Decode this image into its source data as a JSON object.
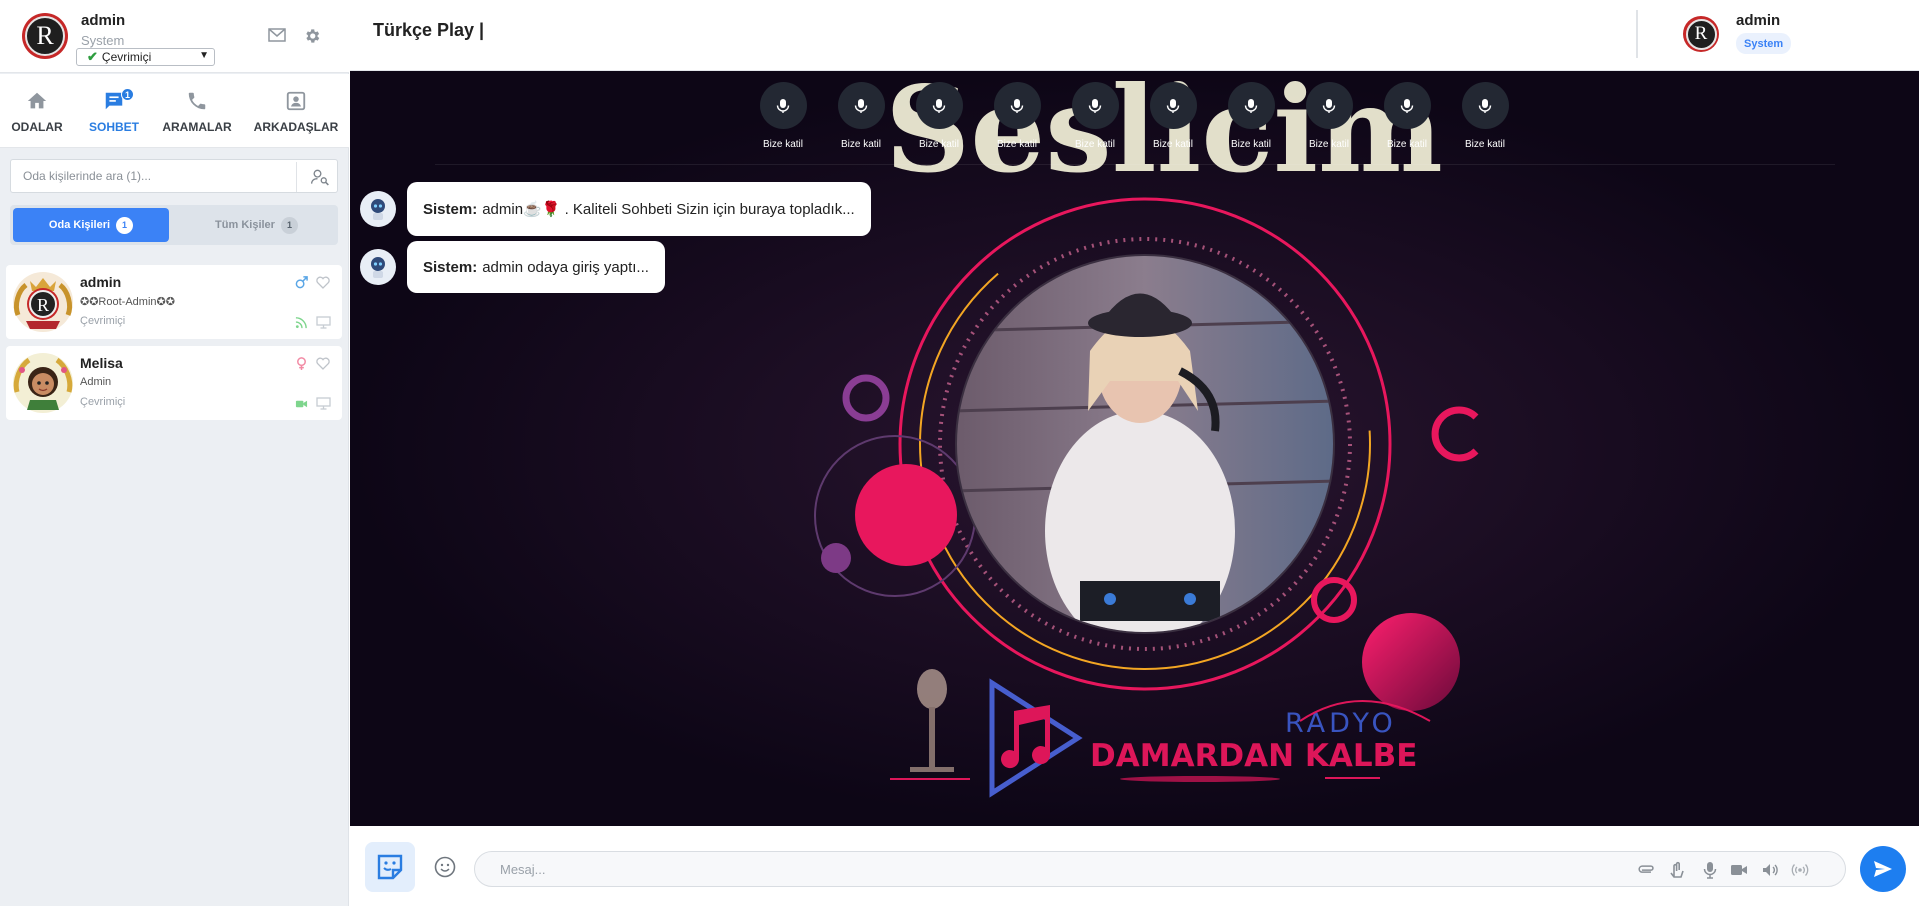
{
  "profile": {
    "name": "admin",
    "role": "System",
    "status": "Çevrimiçi"
  },
  "nav": {
    "tabs": [
      {
        "label": "ODALAR",
        "icon": "home-icon"
      },
      {
        "label": "SOHBET",
        "icon": "chat-icon",
        "badge": "1",
        "active": true
      },
      {
        "label": "ARAMALAR",
        "icon": "phone-icon"
      },
      {
        "label": "ARKADAŞLAR",
        "icon": "contacts-icon"
      }
    ]
  },
  "search": {
    "placeholder": "Oda kişilerinde ara (1)..."
  },
  "subtabs": [
    {
      "label": "Oda Kişileri",
      "count": "1",
      "active": true
    },
    {
      "label": "Tüm Kişiler",
      "count": "1",
      "active": false
    }
  ],
  "users": [
    {
      "name": "admin",
      "role": "✪✪Root-Admin✪✪",
      "status": "Çevrimiçi",
      "gender": "male"
    },
    {
      "name": "Melisa",
      "role": "Admin",
      "status": "Çevrimiçi",
      "gender": "female"
    }
  ],
  "header": {
    "room_title": "Türkçe Play |",
    "user_name": "admin",
    "user_role": "System"
  },
  "seats": {
    "label": "Bize katil",
    "count": 10
  },
  "messages": [
    {
      "sender": "Sistem:",
      "text": "admin☕🌹 . Kaliteli Sohbeti Sizin için buraya topladık..."
    },
    {
      "sender": "Sistem:",
      "text": "admin odaya giriş yaptı..."
    }
  ],
  "stage_art": {
    "logo_text": "Seslicim",
    "radio_line1": "RADYO",
    "radio_line2": "DAMARDAN KALBE"
  },
  "composer": {
    "placeholder": "Mesaj..."
  },
  "colors": {
    "accent": "#1d7ef0",
    "stage_bg": "#0d0616",
    "pink": "#e8175d"
  }
}
